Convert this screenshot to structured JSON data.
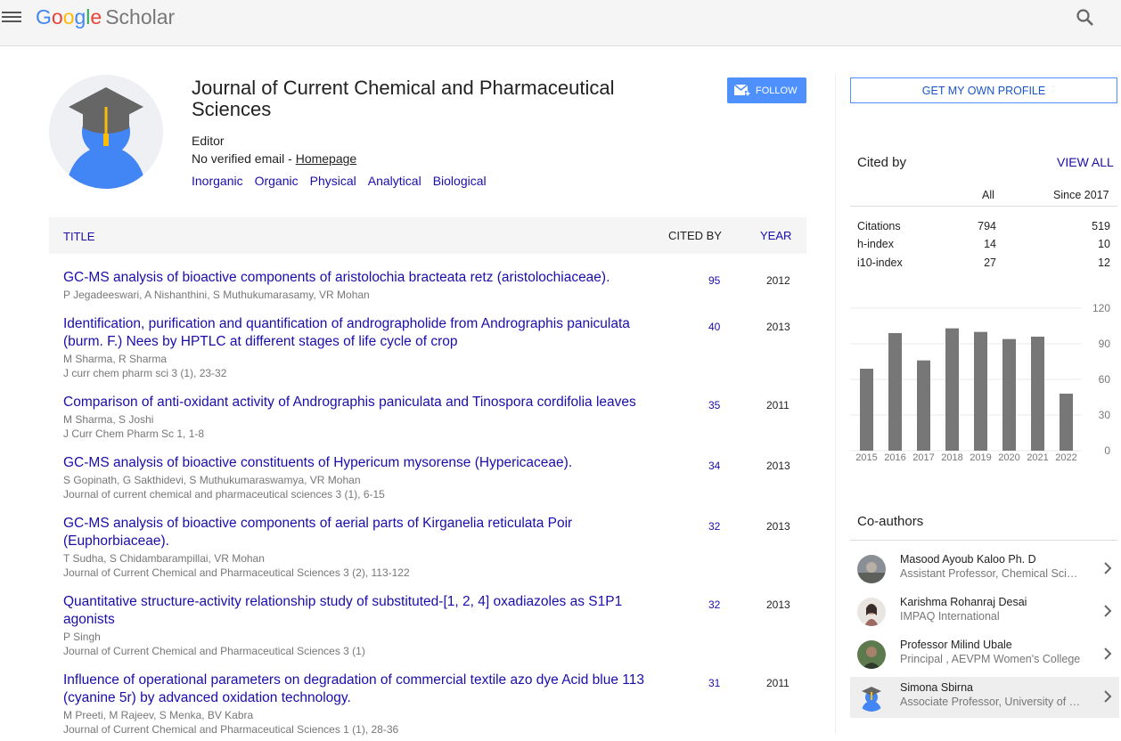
{
  "header": {
    "logo_google": [
      "G",
      "o",
      "o",
      "g",
      "l",
      "e"
    ],
    "logo_scholar": "Scholar"
  },
  "profile": {
    "name": "Journal of Current Chemical and Pharmaceutical Sciences",
    "affiliation": "Editor",
    "email_text": "No verified email - ",
    "homepage": "Homepage",
    "interests": [
      "Inorganic",
      "Organic",
      "Physical",
      "Analytical",
      "Biological"
    ],
    "follow_label": "FOLLOW"
  },
  "table": {
    "col_title": "TITLE",
    "col_cited": "CITED BY",
    "col_year": "YEAR",
    "rows": [
      {
        "title": "GC-MS analysis of bioactive components of aristolochia bracteata retz (aristolochiaceae).",
        "authors": "P Jegadeeswari, A Nishanthini, S Muthukumarasamy, VR Mohan",
        "venue": "",
        "cited": "95",
        "year": "2012"
      },
      {
        "title": "Identification, purification and quantification of andrographolide from Andrographis paniculata (burm. F.) Nees by HPTLC at different stages of life cycle of crop",
        "authors": "M Sharma, R Sharma",
        "venue": "J curr chem pharm sci 3 (1), 23-32",
        "cited": "40",
        "year": "2013"
      },
      {
        "title": "Comparison of anti-oxidant activity of Andrographis paniculata and Tinospora cordifolia leaves",
        "authors": "M Sharma, S Joshi",
        "venue": "J Curr Chem Pharm Sc 1, 1-8",
        "cited": "35",
        "year": "2011"
      },
      {
        "title": "GC-MS analysis of bioactive constituents of Hypericum mysorense (Hypericaceae).",
        "authors": "S Gopinath, G Sakthidevi, S Muthukumaraswamya, VR Mohan",
        "venue": "Journal of current chemical and pharmaceutical sciences 3 (1), 6-15",
        "cited": "34",
        "year": "2013"
      },
      {
        "title": "GC-MS analysis of bioactive components of aerial parts of Kirganelia reticulata Poir (Euphorbiaceae).",
        "authors": "T Sudha, S Chidambarampillai, VR Mohan",
        "venue": "Journal of Current Chemical and Pharmaceutical Sciences 3 (2), 113-122",
        "cited": "32",
        "year": "2013"
      },
      {
        "title": "Quantitative structure-activity relationship study of substituted-[1, 2, 4] oxadiazoles as S1P1 agonists",
        "authors": "P Singh",
        "venue": "Journal of Current Chemical and Pharmaceutical Sciences 3 (1)",
        "cited": "32",
        "year": "2013"
      },
      {
        "title": "Influence of operational parameters on degradation of commercial textile azo dye Acid blue 113 (cyanine 5r) by advanced oxidation technology.",
        "authors": "M Preeti, M Rajeev, S Menka, BV Kabra",
        "venue": "Journal of Current Chemical and Pharmaceutical Sciences 1 (1), 28-36",
        "cited": "31",
        "year": "2011"
      }
    ]
  },
  "sidebar": {
    "own_profile_label": "GET MY OWN PROFILE",
    "cited_by_heading": "Cited by",
    "view_all": "VIEW ALL",
    "col_all": "All",
    "col_since": "Since 2017",
    "metrics": [
      {
        "label": "Citations",
        "all": "794",
        "since": "519"
      },
      {
        "label": "h-index",
        "all": "14",
        "since": "10"
      },
      {
        "label": "i10-index",
        "all": "27",
        "since": "12"
      }
    ],
    "coauthors_heading": "Co-authors",
    "coauthors": [
      {
        "name": "Masood Ayoub Kaloo Ph. D",
        "affiliation": "Assistant Professor, Chemical Sciences"
      },
      {
        "name": "Karishma Rohanraj Desai",
        "affiliation": "IMPAQ International"
      },
      {
        "name": "Professor Milind Ubale",
        "affiliation": "Principal , AEVPM Women's College"
      },
      {
        "name": "Simona Sbirna",
        "affiliation": "Associate Professor, University of Craiova"
      }
    ]
  },
  "colors": {
    "link": "#1a0dab",
    "button": "#4d90fe",
    "bar": "#777777"
  },
  "chart_data": {
    "type": "bar",
    "categories": [
      "2015",
      "2016",
      "2017",
      "2018",
      "2019",
      "2020",
      "2021",
      "2022"
    ],
    "values": [
      69,
      99,
      76,
      103,
      100,
      94,
      96,
      48
    ],
    "yticks": [
      "120",
      "90",
      "60",
      "30",
      "0"
    ],
    "ylim": [
      0,
      120
    ],
    "grid": true
  }
}
